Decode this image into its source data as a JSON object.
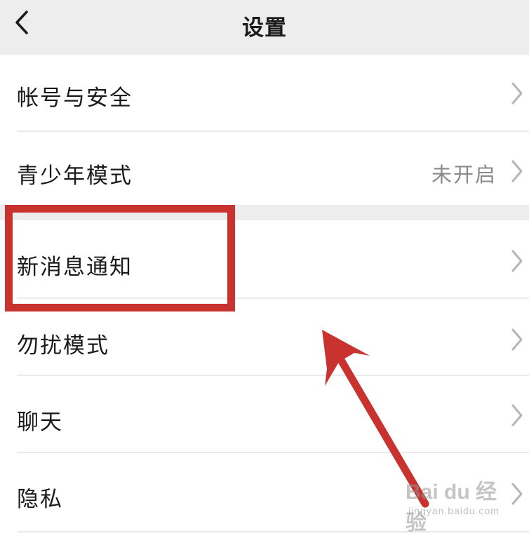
{
  "header": {
    "title": "设置",
    "back_icon": "chevron-left-icon"
  },
  "settings": {
    "rows": [
      {
        "label": "帐号与安全",
        "value": ""
      },
      {
        "label": "青少年模式",
        "value": "未开启"
      },
      {
        "label": "新消息通知",
        "value": ""
      },
      {
        "label": "勿扰模式",
        "value": ""
      },
      {
        "label": "聊天",
        "value": ""
      },
      {
        "label": "隐私",
        "value": ""
      }
    ]
  },
  "annotation": {
    "color": "#c8332f",
    "highlighted_row": "新消息通知"
  },
  "watermark": {
    "brand": "Bai du 经验",
    "url": "jingyan.baidu.com"
  },
  "colors": {
    "header_bg": "#ededed",
    "annotation": "#c8332f"
  }
}
